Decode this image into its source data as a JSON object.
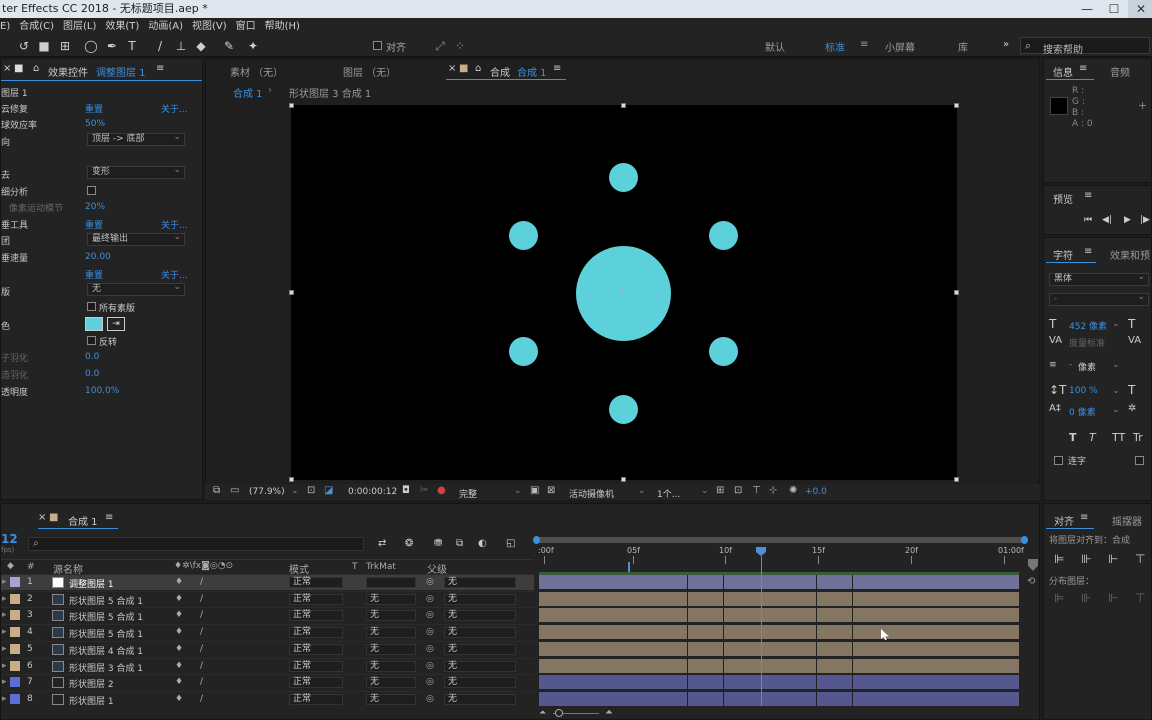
{
  "window": {
    "title": "ter Effects CC 2018 - 无标题项目.aep *"
  },
  "menu": [
    "E)",
    "合成(C)",
    "图层(L)",
    "效果(T)",
    "动画(A)",
    "视图(V)",
    "窗口",
    "帮助(H)"
  ],
  "toolbar": {
    "align_label": "对齐",
    "workspaces": [
      "默认",
      "标准",
      "小屏幕",
      "库"
    ],
    "active_workspace": "标准",
    "search_placeholder": "搜索帮助"
  },
  "effects_panel": {
    "tab_label": "效果控件",
    "tab_layer": "调整图层 1",
    "layer_line": "图层 1",
    "rows": [
      {
        "label": "云修复",
        "reset": "重置",
        "about": "关于..."
      },
      {
        "label": "球效应率",
        "value": "50%"
      },
      {
        "label": "向",
        "value": "顶层 -> 底部"
      },
      {
        "label": "去",
        "value": "变形"
      },
      {
        "label": "细分析"
      },
      {
        "label": "像素运动模节",
        "value": "20%"
      },
      {
        "label": "垂工具",
        "reset": "重置",
        "about": "关于..."
      },
      {
        "label": "团",
        "value": "最终输出"
      },
      {
        "label": "垂速量",
        "value": "20.00"
      },
      {
        "label": "",
        "reset": "重置",
        "about": "关于..."
      },
      {
        "label": "版",
        "value": "无"
      },
      {
        "label": "",
        "check": "所有素版"
      },
      {
        "label": "色"
      },
      {
        "label": "",
        "check": "反转"
      },
      {
        "label": "子羽化",
        "value": "0.0"
      },
      {
        "label": "造羽化",
        "value": "0.0"
      },
      {
        "label": "透明度",
        "value": "100.0%"
      }
    ]
  },
  "viewer_tabs": {
    "footage": "素材 （无）",
    "layer": "图层 （无）",
    "comp_label": "合成",
    "comp_name": "合成 1",
    "breadcrumb1": "合成 1",
    "breadcrumb2": "形状图层 3 合成 1"
  },
  "viewer_bar": {
    "zoom": "(77.9%)",
    "timecode": "0:00:00:12",
    "quality": "完整",
    "camera": "活动摄像机",
    "views": "1个...",
    "exposure": "+0.0"
  },
  "info_panel": {
    "tab1": "信息",
    "tab2": "音频",
    "r": "R :",
    "g": "G :",
    "b": "B :",
    "a": "A : 0"
  },
  "preview_panel": {
    "tab": "预览"
  },
  "character_panel": {
    "tab1": "字符",
    "tab2": "效果和预",
    "font": "黑体",
    "font_size": "452 像素",
    "leading": "度量标准",
    "tracking_unit": "像素",
    "vscale": "100 %",
    "baseline": "0 像素",
    "ligature": "连字"
  },
  "align_panel": {
    "tab1": "对齐",
    "tab2": "摇摆器",
    "align_to": "将图层对齐到：合成",
    "distribute": "分布图层："
  },
  "timeline": {
    "tab": "合成 1",
    "timecode": "12",
    "fps_hint": "fps)",
    "headers": {
      "num": "#",
      "source": "源名称",
      "mode": "模式",
      "t": "T",
      "trkmat": "TrkMat",
      "parent": "父级"
    },
    "ticks": [
      ":00f",
      "05f",
      "10f",
      "15f",
      "20f",
      "01:00f"
    ],
    "layers": [
      {
        "num": "1",
        "name": "调整图层 1",
        "mode": "正常",
        "trk": "",
        "parent": "无",
        "color": "#a6a3d6",
        "bar": "#6f7198",
        "selected": true
      },
      {
        "num": "2",
        "name": "形状图层 5 合成 1",
        "mode": "正常",
        "trk": "无",
        "parent": "无",
        "color": "#c9ad84",
        "bar": "#857663"
      },
      {
        "num": "3",
        "name": "形状图层 5 合成 1",
        "mode": "正常",
        "trk": "无",
        "parent": "无",
        "color": "#c9ad84",
        "bar": "#857663"
      },
      {
        "num": "4",
        "name": "形状图层 5 合成 1",
        "mode": "正常",
        "trk": "无",
        "parent": "无",
        "color": "#c9ad84",
        "bar": "#857663"
      },
      {
        "num": "5",
        "name": "形状图层 4 合成 1",
        "mode": "正常",
        "trk": "无",
        "parent": "无",
        "color": "#c9ad84",
        "bar": "#857663"
      },
      {
        "num": "6",
        "name": "形状图层 3 合成 1",
        "mode": "正常",
        "trk": "无",
        "parent": "无",
        "color": "#c9ad84",
        "bar": "#857663"
      },
      {
        "num": "7",
        "name": "形状图层 2",
        "mode": "正常",
        "trk": "无",
        "parent": "无",
        "color": "#5a6fd1",
        "bar": "#54588e"
      },
      {
        "num": "8",
        "name": "形状图层 1",
        "mode": "正常",
        "trk": "无",
        "parent": "无",
        "color": "#5a6fd1",
        "bar": "#54588e"
      }
    ]
  },
  "colors": {
    "accent": "#3b8fe0",
    "shape_fill": "#5dd1d9",
    "playhead": "#4f8fd8"
  }
}
